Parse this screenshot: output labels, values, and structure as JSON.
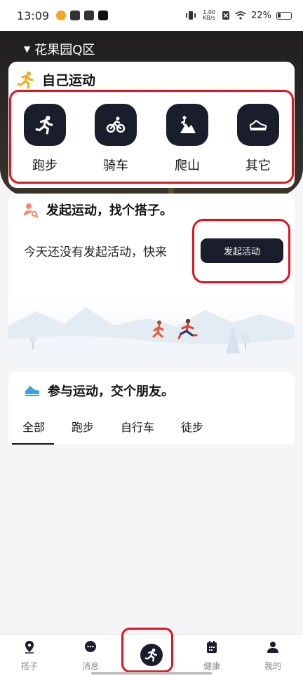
{
  "status_bar": {
    "time": "13:09",
    "net_speed_value": "1.00",
    "net_speed_unit": "KB/s",
    "battery": "22%"
  },
  "header": {
    "location": "花果园Q区"
  },
  "self_sport": {
    "title": "自己运动",
    "items": [
      {
        "label": "跑步",
        "icon": "running-icon"
      },
      {
        "label": "骑车",
        "icon": "cycling-icon"
      },
      {
        "label": "爬山",
        "icon": "hiking-icon"
      },
      {
        "label": "其它",
        "icon": "shoe-icon"
      }
    ]
  },
  "start_activity": {
    "title": "发起运动，找个搭子。",
    "description": "今天还没有发起活动，快来",
    "button_label": "发起活动"
  },
  "join_activity": {
    "title": "参与运动，交个朋友。",
    "tabs": [
      "全部",
      "跑步",
      "自行车",
      "徒步"
    ],
    "selected_tab": "全部"
  },
  "bottom_nav": {
    "items": [
      {
        "label": "搭子",
        "icon": "location-pin-icon"
      },
      {
        "label": "消息",
        "icon": "chat-bubble-icon"
      },
      {
        "label": "",
        "icon": "running-icon"
      },
      {
        "label": "健康",
        "icon": "calendar-icon"
      },
      {
        "label": "我的",
        "icon": "person-icon"
      }
    ]
  },
  "colors": {
    "accent_dark": "#1a1d2b",
    "highlight_red": "#e0141f",
    "orange_icon": "#f5a623"
  }
}
